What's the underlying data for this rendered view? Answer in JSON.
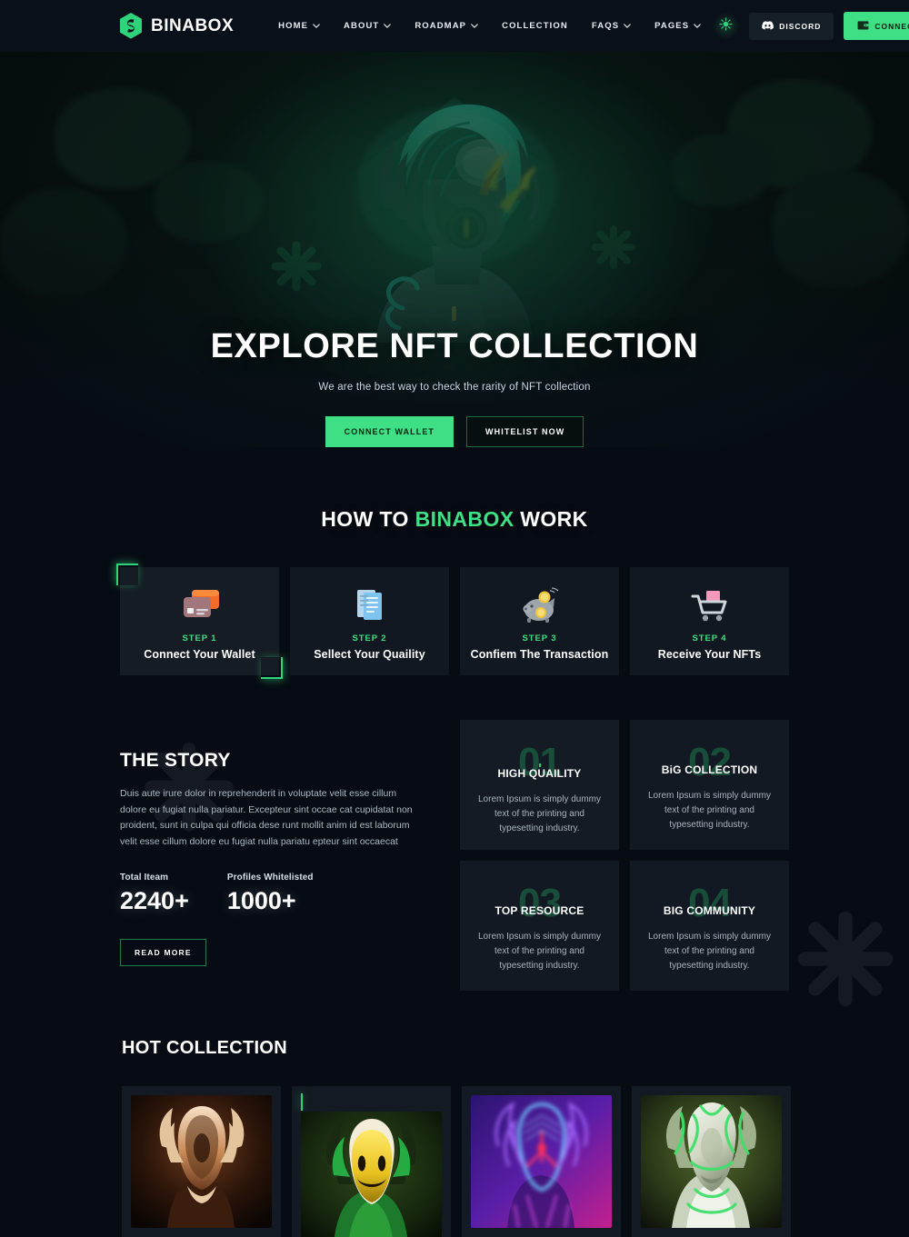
{
  "theme": {
    "accent": "#3fe085",
    "accent_dark": "#1d7b4c",
    "bg": "#070c14",
    "nav_bg": "#0a1019",
    "card_bg": "#151c24",
    "text_muted": "#aeb8c4"
  },
  "nav": {
    "brand": "BINABOX",
    "brand_icon": "hexagon-logo-icon",
    "links": [
      {
        "label": "HOME",
        "has_dropdown": true
      },
      {
        "label": "ABOUT",
        "has_dropdown": true
      },
      {
        "label": "ROADMAP",
        "has_dropdown": true
      },
      {
        "label": "COLLECTION",
        "has_dropdown": false
      },
      {
        "label": "FAQS",
        "has_dropdown": true
      },
      {
        "label": "PAGES",
        "has_dropdown": true
      }
    ],
    "theme_toggle_icon": "sun-burst-icon",
    "discord_label": "DISCORD",
    "discord_icon": "discord-icon",
    "connect_label": "CONNECT",
    "connect_icon": "wallet-icon"
  },
  "hero": {
    "title": "EXPLORE NFT COLLECTION",
    "subtitle": "We are the best way to check the rarity of NFT collection",
    "primary_button": "CONNECT WALLET",
    "secondary_button": "WHITELIST NOW",
    "artwork": "cyborg-alien-character"
  },
  "how_it_works": {
    "title_prefix": "HOW TO ",
    "title_highlight": "BINABOX",
    "title_suffix": " WORK",
    "steps": [
      {
        "num": "STEP 1",
        "name": "Connect Your Wallet",
        "icon": "credit-cards-icon"
      },
      {
        "num": "STEP 2",
        "name": "Sellect Your Quaility",
        "icon": "documents-icon"
      },
      {
        "num": "STEP 3",
        "name": "Confiem The Transaction",
        "icon": "piggy-bank-icon"
      },
      {
        "num": "STEP 4",
        "name": "Receive Your NFTs",
        "icon": "shopping-cart-icon"
      }
    ]
  },
  "story": {
    "title": "THE STORY",
    "body": "Duis aute irure dolor in reprehenderit in voluptate velit esse cillum dolore eu fugiat nulla pariatur. Excepteur sint occae cat cupidatat non proident, sunt in culpa qui officia dese runt mollit anim id est laborum velit esse cillum dolore eu fugiat nulla pariatu epteur sint occaecat",
    "stats": [
      {
        "label": "Total Iteam",
        "value": "2240+"
      },
      {
        "label": "Profiles Whitelisted",
        "value": "1000+"
      }
    ],
    "read_more": "READ MORE"
  },
  "features": [
    {
      "number": "01",
      "title": "HIGH QUAILITY",
      "desc": "Lorem Ipsum is simply dummy text of the printing and typesetting industry."
    },
    {
      "number": "02",
      "title": "BiG COLLECTION",
      "desc": "Lorem Ipsum is simply dummy text of the printing and typesetting industry."
    },
    {
      "number": "03",
      "title": "TOP RESOURCE",
      "desc": "Lorem Ipsum is simply dummy text of the printing and typesetting industry."
    },
    {
      "number": "04",
      "title": "BIG COMMUNITY",
      "desc": "Lorem Ipsum is simply dummy text of the printing and typesetting industry."
    }
  ],
  "hot_collection": {
    "title": "HOT COLLECTION",
    "items": [
      {
        "art": "bronze-alien-head"
      },
      {
        "art": "yellow-smiley-alien"
      },
      {
        "art": "neon-purple-alien"
      },
      {
        "art": "green-chrome-alien"
      }
    ]
  }
}
